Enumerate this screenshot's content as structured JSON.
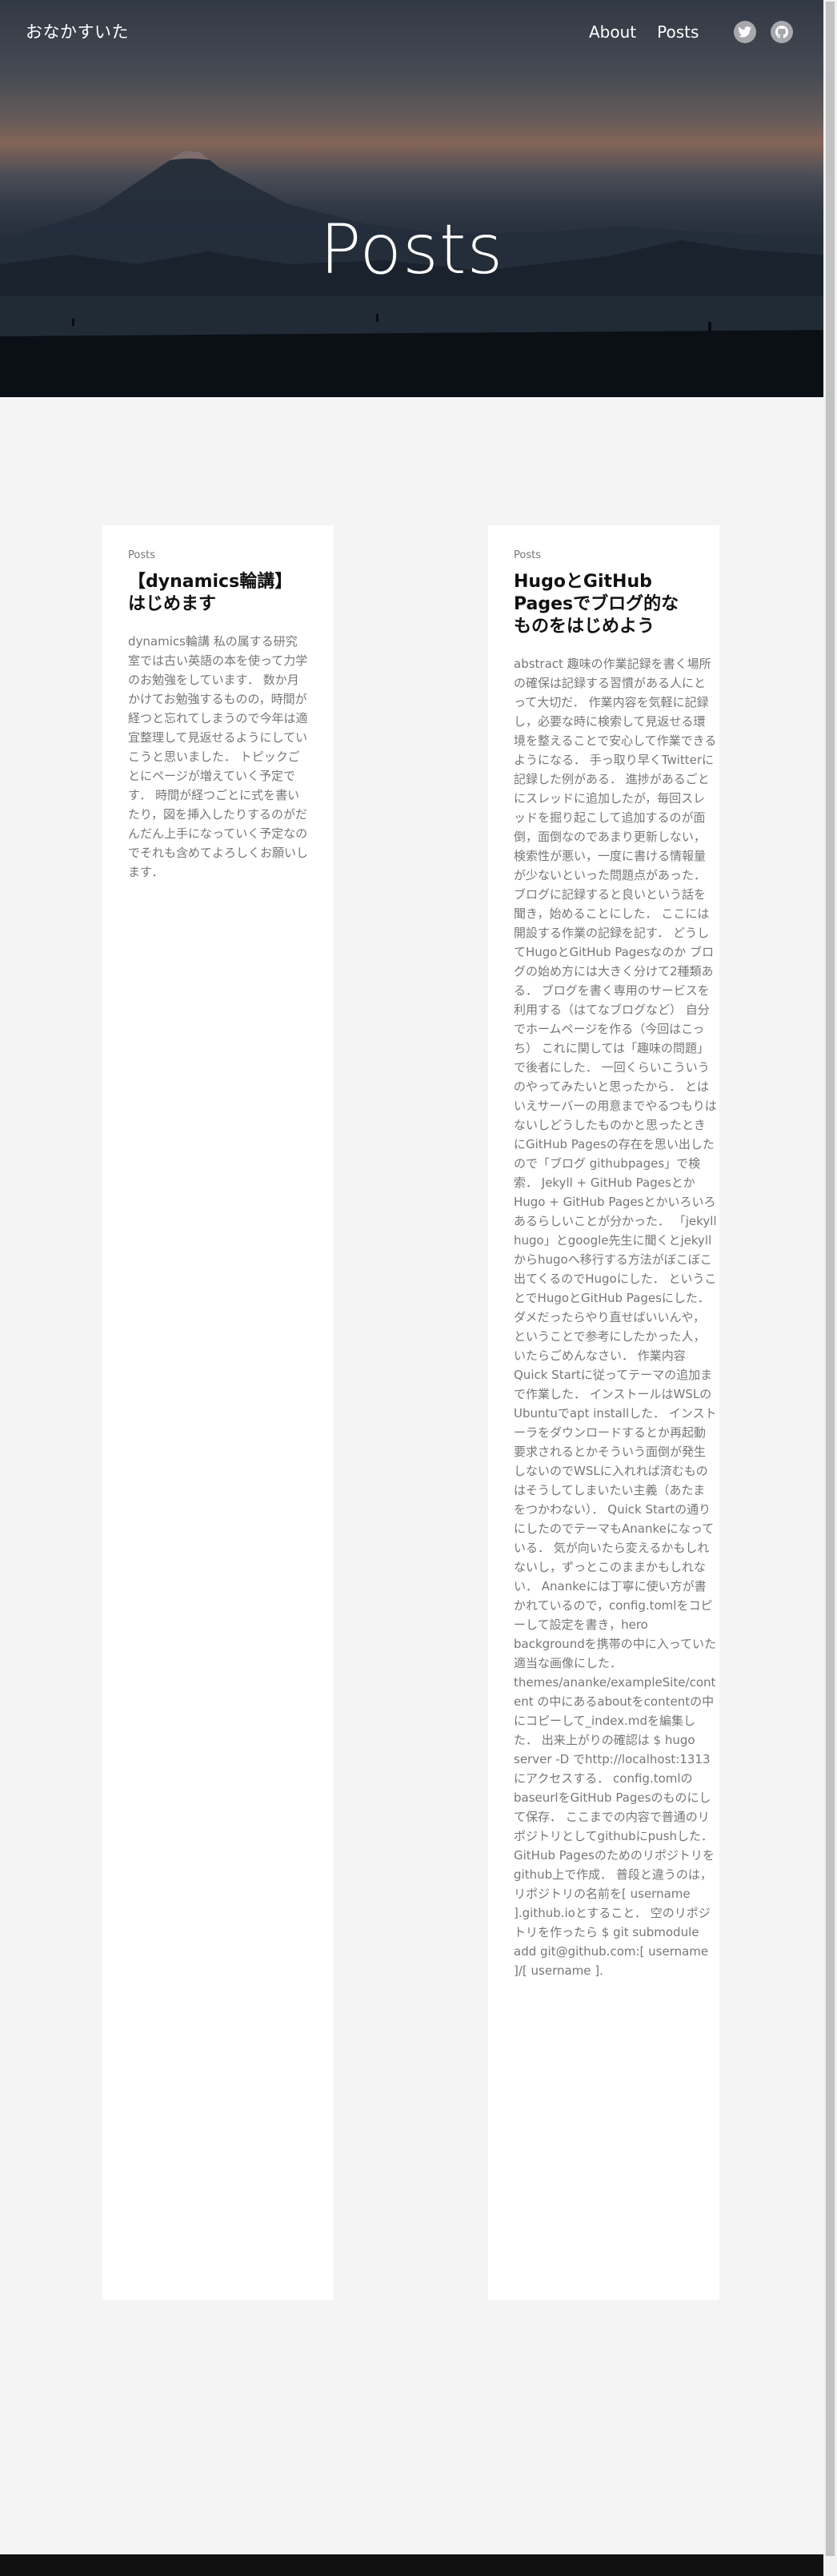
{
  "site": {
    "title": "おなかすいた"
  },
  "nav": {
    "about": "About",
    "posts": "Posts"
  },
  "social": {
    "twitter_icon": "twitter-icon",
    "github_icon": "github-icon"
  },
  "hero": {
    "title": "Posts"
  },
  "posts": [
    {
      "type": "Posts",
      "title": "【dynamics輪講】はじめます",
      "summary": "dynamics輪講 私の属する研究室では古い英語の本を使って力学のお勉強をしています． 数か月かけてお勉強するものの，時間が経つと忘れてしまうので今年は適宜整理して見返せるようにしていこうと思いました． トピックごとにページが増えていく予定です． 時間が経つごとに式を書いたり，図を挿入したりするのがだんだん上手になっていく予定なのでそれも含めてよろしくお願いします．"
    },
    {
      "type": "Posts",
      "title": "HugoとGitHub Pagesでブログ的なものをはじめよう",
      "summary": "abstract 趣味の作業記録を書く場所の確保は記録する習慣がある人にとって大切だ． 作業内容を気軽に記録し，必要な時に検索して見返せる環境を整えることで安心して作業できるようになる． 手っ取り早くTwitterに記録した例がある． 進捗があるごとにスレッドに追加したが，毎回スレッドを掘り起こして追加するのが面倒，面倒なのであまり更新しない，検索性が悪い，一度に書ける情報量が少ないといった問題点があった． ブログに記録すると良いという話を聞き，始めることにした． ここには開設する作業の記録を記す． どうしてHugoとGitHub Pagesなのか ブログの始め方には大きく分けて2種類ある． ブログを書く専用のサービスを利用する（はてなブログなど） 自分でホームページを作る（今回はこっち） これに関しては「趣味の問題」で後者にした． 一回くらいこういうのやってみたいと思ったから． とはいえサーバーの用意までやるつもりはないしどうしたものかと思ったときにGitHub Pagesの存在を思い出したので「ブログ githubpages」で検索． Jekyll + GitHub PagesとかHugo + GitHub Pagesとかいろいろあるらしいことが分かった． 「jekyll hugo」とgoogle先生に聞くとjekyllからhugoへ移行する方法がぼこぼこ出てくるのでHugoにした． ということでHugoとGitHub Pagesにした． ダメだったらやり直せばいいんや， ということで参考にしたかった人，いたらごめんなさい． 作業内容 Quick Startに従ってテーマの追加まで作業した． インストールはWSLのUbuntuでapt installした． インストーラをダウンロードするとか再起動要求されるとかそういう面倒が発生しないのでWSLに入れれば済むものはそうしてしまいたい主義（あたまをつかわない）． Quick Startの通りにしたのでテーマもAnankeになっている． 気が向いたら変えるかもしれないし，ずっとこのままかもしれない． Anankeには丁寧に使い方が書かれているので，config.tomlをコピーして設定を書き，hero backgroundを携帯の中に入っていた適当な画像にした． themes/ananke/exampleSite/content の中にあるaboutをcontentの中にコピーして_index.mdを編集した． 出来上がりの確認は $ hugo server -D でhttp://localhost:1313にアクセスする． config.tomlのbaseurlをGitHub Pagesのものにして保存． ここまでの内容で普通のリポジトリとしてgithubにpushした． GitHub Pagesのためのリポジトリをgithub上で作成． 普段と違うのは，リポジトリの名前を[ username ].github.ioとすること． 空のリポジトリを作ったら $ git submodule add git@github.com:[ username ]/[ username ]."
    }
  ],
  "colors": {
    "background": "#f4f4f4",
    "card": "#ffffff",
    "text_muted": "#777777",
    "footer": "#111111"
  }
}
